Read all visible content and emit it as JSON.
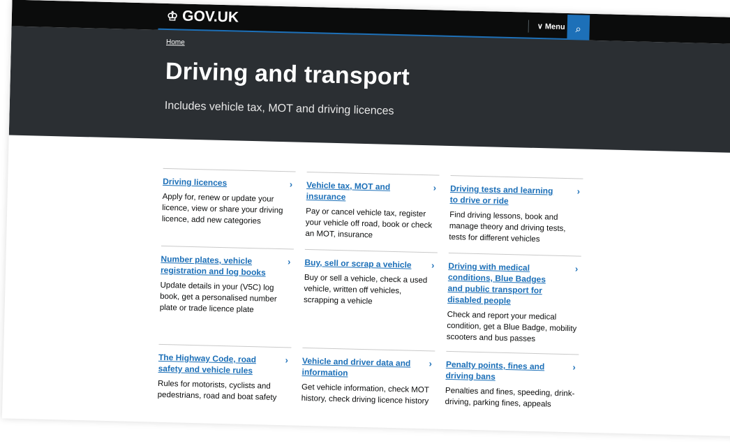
{
  "header": {
    "logo_text": "GOV.UK",
    "crown_icon": "crown-icon",
    "menu_label": "∨ Menu",
    "search_icon": "search-icon"
  },
  "breadcrumb": {
    "home": "Home"
  },
  "hero": {
    "title": "Driving and transport",
    "subtitle": "Includes vehicle tax, MOT and driving licences"
  },
  "cards": [
    {
      "title": "Driving licences",
      "desc": "Apply for, renew or update your licence, view or share your driving licence, add new categories"
    },
    {
      "title": "Vehicle tax, MOT and insurance",
      "desc": "Pay or cancel vehicle tax, register your vehicle off road, book or check an MOT, insurance"
    },
    {
      "title": "Driving tests and learning to drive or ride",
      "desc": "Find driving lessons, book and manage theory and driving tests, tests for different vehicles"
    },
    {
      "title": "Number plates, vehicle registration and log books",
      "desc": "Update details in your (V5C) log book, get a personalised number plate or trade licence plate"
    },
    {
      "title": "Buy, sell or scrap a vehicle",
      "desc": "Buy or sell a vehicle, check a used vehicle, written off vehicles, scrapping a vehicle"
    },
    {
      "title": "Driving with medical conditions, Blue Badges and public transport for disabled people",
      "desc": "Check and report your medical condition, get a Blue Badge, mobility scooters and bus passes"
    },
    {
      "title": "The Highway Code, road safety and vehicle rules",
      "desc": "Rules for motorists, cyclists and pedestrians, road and boat safety"
    },
    {
      "title": "Vehicle and driver data and information",
      "desc": "Get vehicle information, check MOT history, check driving licence history"
    },
    {
      "title": "Penalty points, fines and driving bans",
      "desc": "Penalties and fines, speeding, drink-driving, parking fines, appeals"
    }
  ],
  "colors": {
    "header_bg": "#0b0c0c",
    "hero_bg": "#2b2f33",
    "link_blue": "#1d70b8"
  }
}
